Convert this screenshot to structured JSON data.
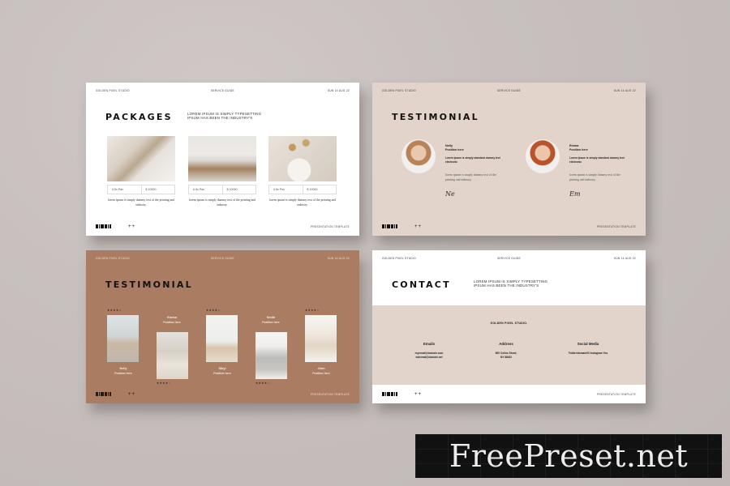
{
  "slides": {
    "header": {
      "studio": "Golden Pixel Studio",
      "guide": "Service Guide",
      "date": "Sun 14 Aug 22"
    },
    "footer": {
      "plus": "++",
      "label": "Presentation Template"
    },
    "packages": {
      "title": "PACKAGES",
      "subtitle": "LOREM IPSUM IS SIMPLY TYPESETTING IPSUM HAS BEEN THE INDUSTRY'S",
      "items": [
        {
          "photo": "bag-and-bottle-photo",
          "count": "# 8x Pax",
          "price": "$ 10000",
          "desc": "lorem ipsum is simply dummy text of the printing and industry."
        },
        {
          "photo": "living-room-photo",
          "count": "# 8x Pax",
          "price": "$ 10000",
          "desc": "lorem ipsum is simply dummy text of the printing and industry."
        },
        {
          "photo": "vase-dried-flowers-photo",
          "count": "# 8x Pax",
          "price": "$ 10000",
          "desc": "lorem ipsum is simply dummy text of the printing and industry."
        }
      ]
    },
    "testimonial1": {
      "title": "TESTIMONIAL",
      "people": [
        {
          "name": "Nelly",
          "position": "Position here",
          "bold": "Lorem Ipsum is simply standard dummy text electronic",
          "text": "lorem ipsum is simply dummy text of the printing and industry.",
          "signature": "Ne"
        },
        {
          "name": "Emma",
          "position": "Position here",
          "bold": "Lorem Ipsum is simply standard dummy text electronic",
          "text": "lorem ipsum is simply dummy text of the printing and industry.",
          "signature": "Em"
        }
      ]
    },
    "testimonial2": {
      "title": "TESTIMONIAL",
      "people": [
        {
          "name": "Nelly",
          "position": "Position here",
          "rating": 4,
          "stars": "★★★★☆"
        },
        {
          "name": "Emma",
          "position": "Position here",
          "rating": 4,
          "stars": "★★★★☆"
        },
        {
          "name": "Sibyl",
          "position": "Position here",
          "rating": 4,
          "stars": "★★★★☆"
        },
        {
          "name": "Smith",
          "position": "Position here",
          "rating": 4,
          "stars": "★★★★☆"
        },
        {
          "name": "Jhon",
          "position": "Position here",
          "rating": 4,
          "stars": "★★★★☆"
        }
      ]
    },
    "contact": {
      "title": "CONTACT",
      "subtitle": "LOREM IPSUM IS SIMPLY TYPESETTING IPSUM HAS BEEN THE INDUSTRY'S",
      "company": "GOLDEN PIXEL STUDIO.",
      "columns": [
        {
          "heading": "Emails",
          "lines": [
            "myemail@domain.com",
            "mdemail@domain.net"
          ]
        },
        {
          "heading": "Address",
          "lines": [
            "560 Colins Street,",
            "NY 88402"
          ]
        },
        {
          "heading": "Social Media",
          "lines": [
            "Twitter/domain93 Instagram Yos"
          ]
        }
      ]
    }
  },
  "watermark": "FreePreset.net",
  "colors": {
    "background": "#c7c0be",
    "beige": "#e2d4cb",
    "brown": "#aa7c62",
    "white": "#ffffff",
    "ink": "#111111"
  }
}
